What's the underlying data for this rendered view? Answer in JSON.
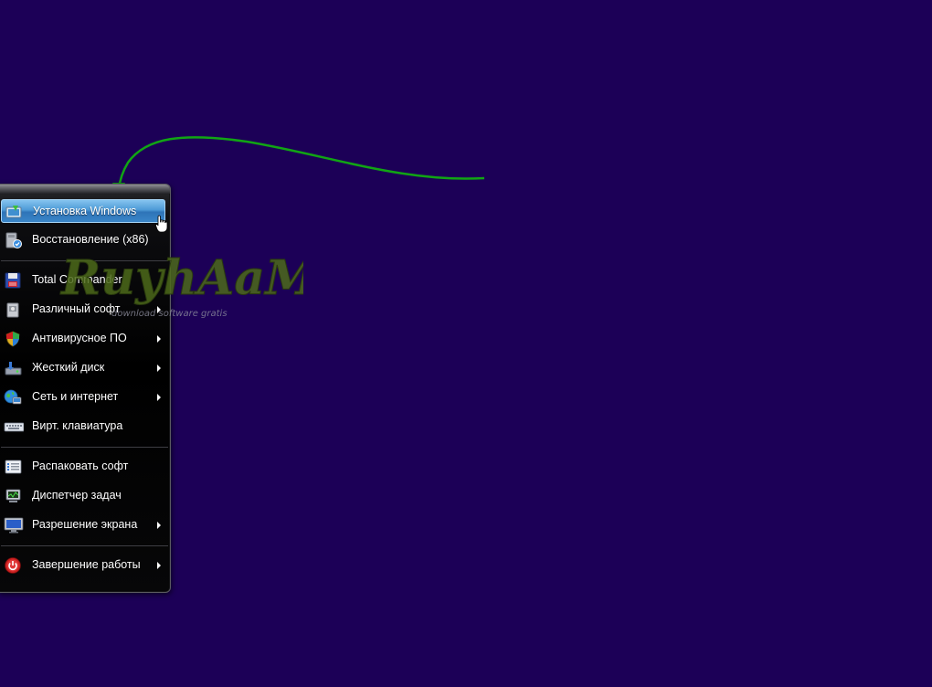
{
  "desktop": {
    "background_color": "#1c0057",
    "annotation_arrow_color": "#11a514"
  },
  "watermark": {
    "logo_text": "RuyhAaMe",
    "tagline": "download software gratis"
  },
  "menu": {
    "items": [
      {
        "label": "Установка Windows",
        "icon": "windows-setup-icon",
        "has_submenu": false,
        "active": true
      },
      {
        "label": "Восстановление (x86)",
        "icon": "recovery-icon",
        "has_submenu": false,
        "active": false
      },
      {
        "label": "Total Commander",
        "icon": "floppy-disk-icon",
        "has_submenu": false,
        "active": false
      },
      {
        "label": "Различный софт",
        "icon": "software-box-icon",
        "has_submenu": true,
        "active": false
      },
      {
        "label": "Антивирусное ПО",
        "icon": "shield-icon",
        "has_submenu": true,
        "active": false
      },
      {
        "label": "Жесткий диск",
        "icon": "hard-disk-icon",
        "has_submenu": true,
        "active": false
      },
      {
        "label": "Сеть и интернет",
        "icon": "network-globe-icon",
        "has_submenu": true,
        "active": false
      },
      {
        "label": "Вирт. клавиатура",
        "icon": "keyboard-icon",
        "has_submenu": false,
        "active": false
      },
      {
        "label": "Распаковать софт",
        "icon": "unpack-list-icon",
        "has_submenu": false,
        "active": false
      },
      {
        "label": "Диспетчер задач",
        "icon": "task-manager-icon",
        "has_submenu": false,
        "active": false
      },
      {
        "label": "Разрешение экрана",
        "icon": "monitor-icon",
        "has_submenu": true,
        "active": false
      },
      {
        "label": "Завершение работы",
        "icon": "power-icon",
        "has_submenu": true,
        "active": false
      }
    ]
  }
}
